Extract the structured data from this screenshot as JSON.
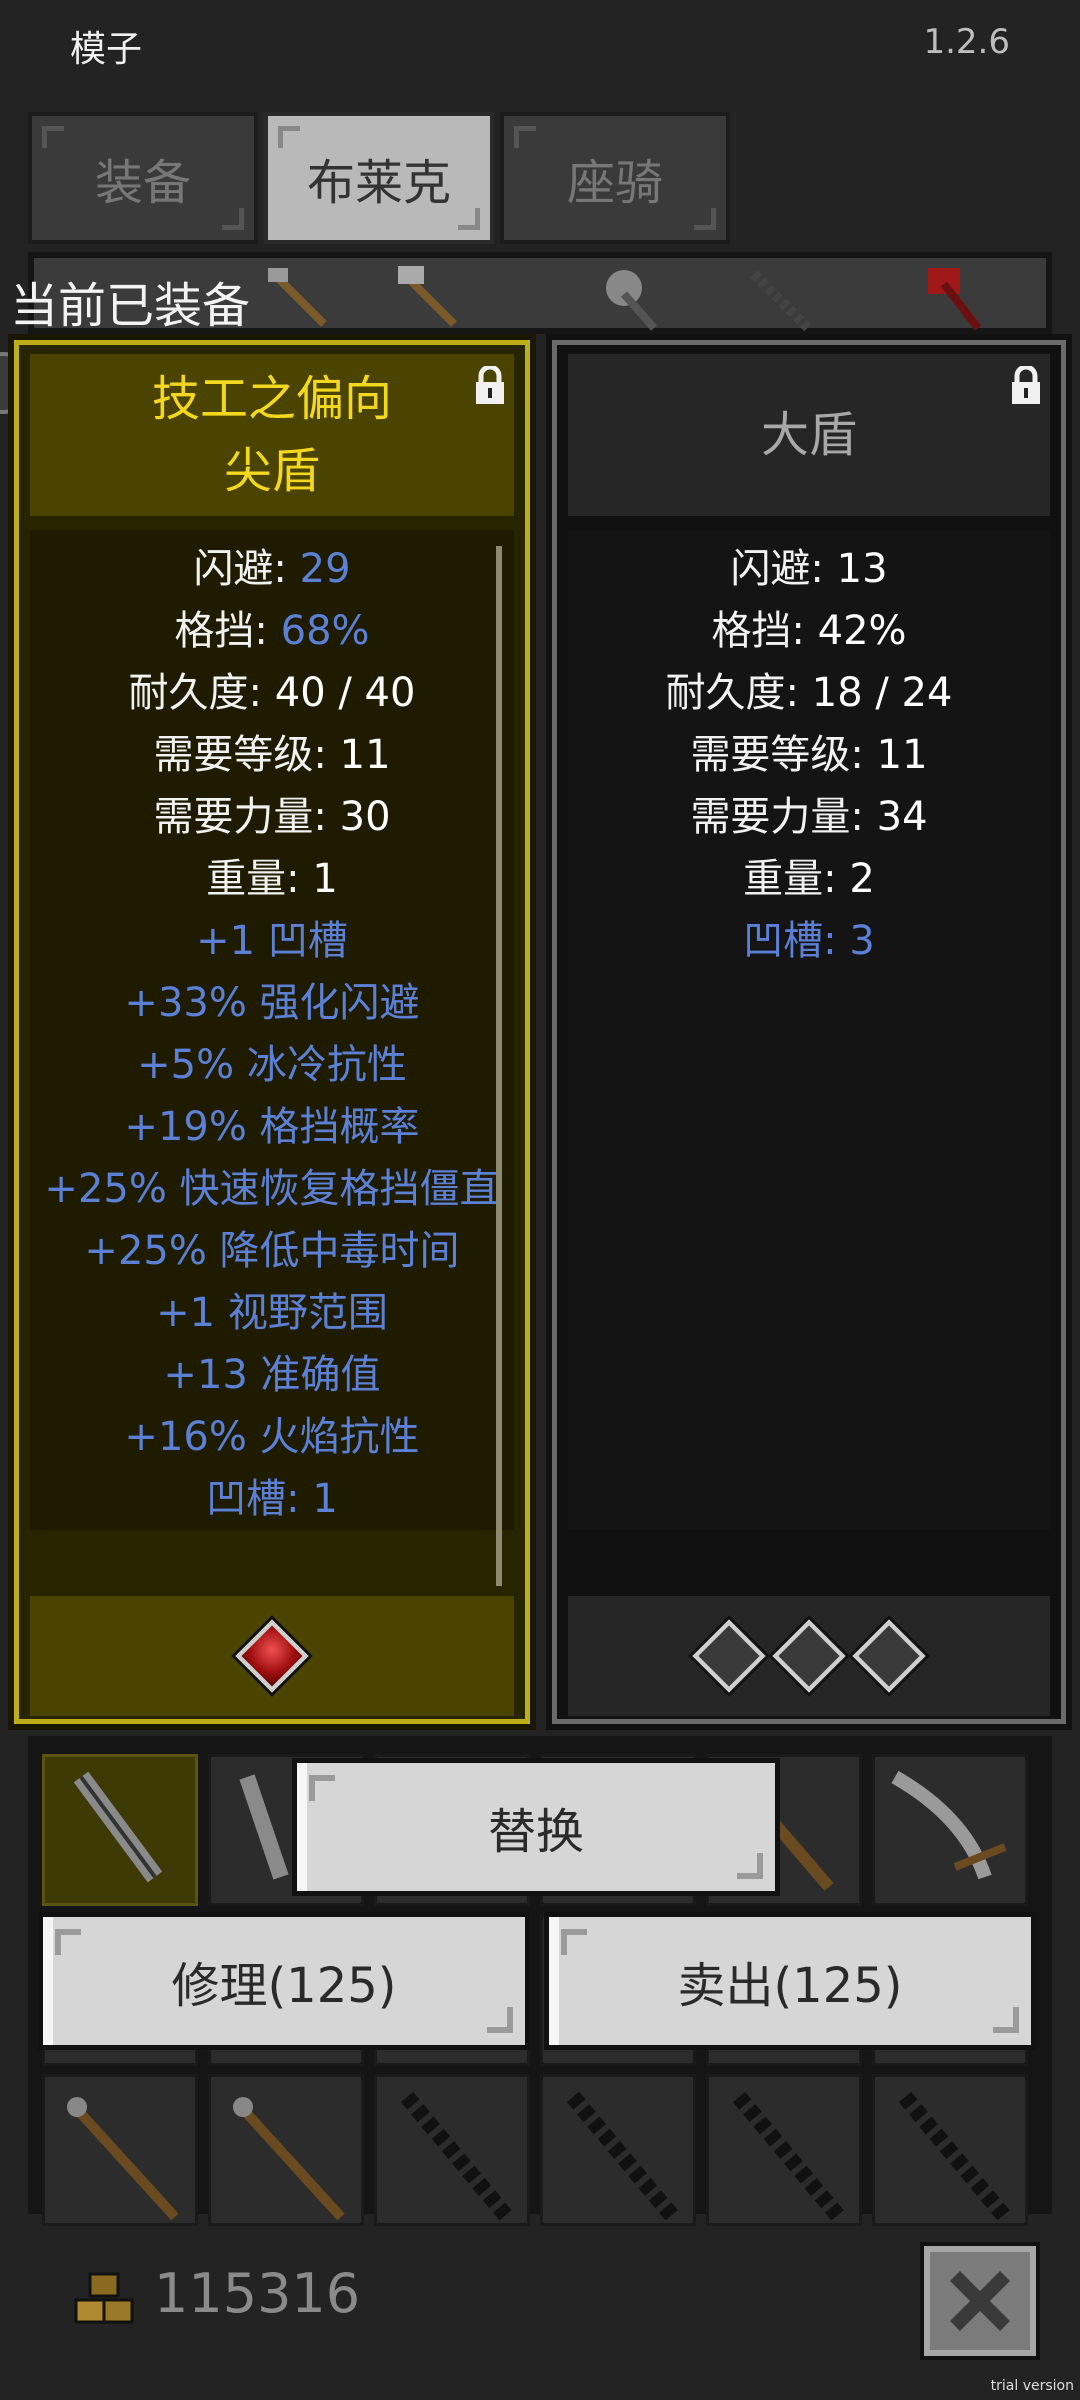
{
  "header": {
    "title": "模子",
    "version": "1.2.6"
  },
  "tabs": [
    {
      "label": "装备",
      "active": false
    },
    {
      "label": "布莱克",
      "active": true
    },
    {
      "label": "座骑",
      "active": false
    }
  ],
  "section_label": "当前已装备",
  "left_item": {
    "name_line1": "技工之偏向",
    "name_line2": "尖盾",
    "stats": [
      {
        "label": "闪避: ",
        "value": "29",
        "value_blue": true
      },
      {
        "label": "格挡: ",
        "value": "68%",
        "value_blue": true
      },
      {
        "label": "耐久度: ",
        "value": "40 / 40",
        "value_blue": false
      },
      {
        "label": "需要等级: ",
        "value": "11",
        "value_blue": false
      },
      {
        "label": "需要力量: ",
        "value": "30",
        "value_blue": false
      },
      {
        "label": "重量: ",
        "value": "1",
        "value_blue": false
      }
    ],
    "affixes": [
      "+1 凹槽",
      "+33% 强化闪避",
      "+5% 冰冷抗性",
      "+19% 格挡概率",
      "+25% 快速恢复格挡僵直",
      "+25% 降低中毒时间",
      "+1 视野范围",
      "+13 准确值",
      "+16% 火焰抗性",
      "凹槽: 1"
    ],
    "sockets": [
      "ruby"
    ]
  },
  "right_item": {
    "name_line1": "大盾",
    "stats": [
      {
        "label": "闪避: ",
        "value": "13"
      },
      {
        "label": "格挡: ",
        "value": "42%"
      },
      {
        "label": "耐久度: ",
        "value": "18 / 24"
      },
      {
        "label": "需要等级: ",
        "value": "11"
      },
      {
        "label": "需要力量: ",
        "value": "34"
      },
      {
        "label": "重量: ",
        "value": "2"
      }
    ],
    "affixes": [
      "凹槽: 3"
    ],
    "sockets": [
      "empty",
      "empty",
      "empty"
    ]
  },
  "buttons": {
    "replace": "替换",
    "repair": "修理(125)",
    "sell": "卖出(125)"
  },
  "footer": {
    "gold": "115316",
    "trial": "trial version"
  },
  "colors": {
    "accent_yellow": "#f4d81f",
    "stat_blue": "#5b80d6"
  }
}
